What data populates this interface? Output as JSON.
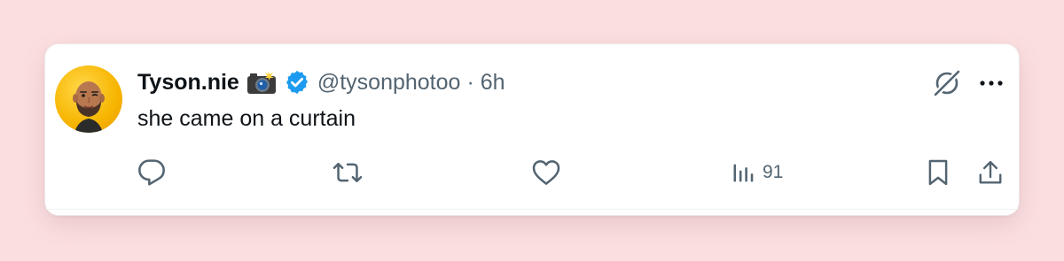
{
  "tweet": {
    "author_name": "Tyson.nie",
    "handle": "@tysonphotoo",
    "separator": "·",
    "time": "6h",
    "text": "she came on a curtain",
    "verified": true
  },
  "actions": {
    "views_count": "91"
  },
  "icons": [
    "camera-flash-emoji-icon",
    "verified-badge-icon",
    "grok-icon",
    "more-icon",
    "reply-icon",
    "retweet-icon",
    "like-icon",
    "views-icon",
    "bookmark-icon",
    "share-icon"
  ],
  "colors": {
    "background": "#fbdfe0",
    "card": "#ffffff",
    "text": "#0f1419",
    "secondary": "#536471",
    "verified": "#1d9bf0"
  }
}
